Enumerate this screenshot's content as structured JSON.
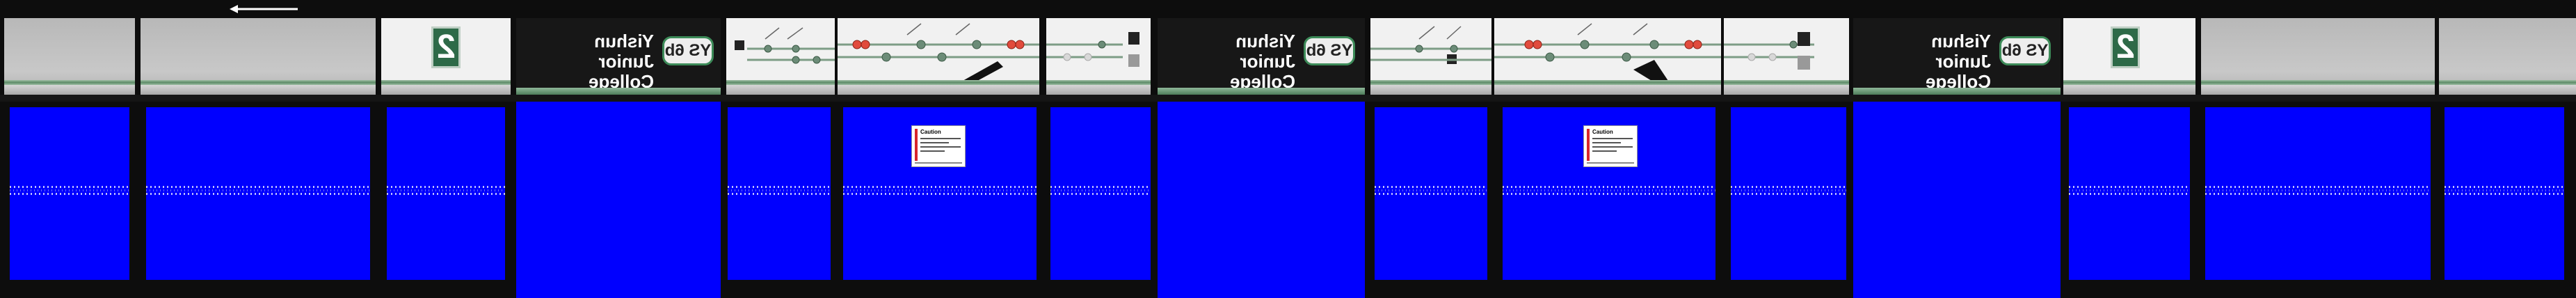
{
  "colors": {
    "door_blue": "#0000ff",
    "panel_grey": "#c0c0c0",
    "panel_dark": "#171717",
    "accent_green": "#3c8a58",
    "route_red": "#e14b3d",
    "caution_red": "#d7262c"
  },
  "direction_arrow": {
    "icon": "arrow-left-icon"
  },
  "station_signs": [
    {
      "code": "YS 6b",
      "name_line1": "Yishun",
      "name_line2": "Junior College"
    },
    {
      "code": "YS 6b",
      "name_line1": "Yishun",
      "name_line2": "Junior College"
    },
    {
      "code": "YS 6b",
      "name_line1": "Yishun",
      "name_line2": "Junior College"
    }
  ],
  "platform_signs": [
    {
      "number": "2"
    },
    {
      "number": "2"
    }
  ],
  "caution_signs": [
    {
      "title": "Caution"
    },
    {
      "title": "Caution"
    }
  ]
}
